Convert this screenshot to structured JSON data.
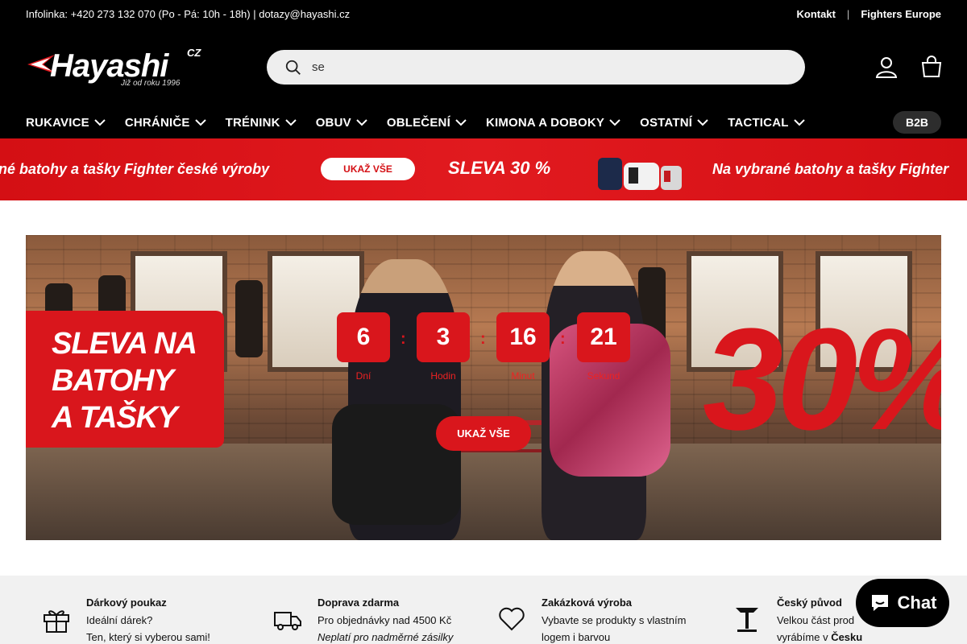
{
  "topbar": {
    "info": "Infolinka: +420 273 132 070 (Po - Pá: 10h - 18h) | dotazy@hayashi.cz",
    "contact_link": "Kontakt",
    "separator": "|",
    "europe_link": "Fighters Europe"
  },
  "logo": {
    "wordmark": "Hayashi",
    "cz": "CZ",
    "tagline": "Již od roku 1996"
  },
  "search": {
    "value": "se"
  },
  "nav": {
    "items": [
      "RUKAVICE",
      "CHRÁNIČE",
      "TRÉNINK",
      "OBUV",
      "OBLEČENÍ",
      "KIMONA A DOBOKY",
      "OSTATNÍ",
      "TACTICAL"
    ],
    "b2b": "B2B"
  },
  "promo_strip": {
    "left_text": "né batohy a tašky Fighter české výroby",
    "button": "UKAŽ VŠE",
    "discount": "SLEVA 30 %",
    "right_text": "Na vybrané batohy a tašky Fighter"
  },
  "hero": {
    "headline": [
      "SLEVA NA",
      "BATOHY",
      "A TAŠKY"
    ],
    "big_text": "30%",
    "countdown": [
      {
        "value": "6",
        "label": "Dní"
      },
      {
        "value": "3",
        "label": "Hodin"
      },
      {
        "value": "16",
        "label": "Minut"
      },
      {
        "value": "21",
        "label": "Sekund"
      }
    ],
    "cta": "UKAŽ VŠE"
  },
  "features": [
    {
      "title": "Dárkový poukaz",
      "line1": "Ideální dárek?",
      "line2": "Ten, který si vyberou sami!",
      "icon": "gift-icon"
    },
    {
      "title": "Doprava zdarma",
      "line1": "Pro objednávky nad 4500 Kč",
      "line2": "Neplatí pro nadměrné zásilky",
      "icon": "truck-icon"
    },
    {
      "title": "Zakázková výroba",
      "line1": "Vybavte se produkty s vlastním",
      "line2": "logem i barvou",
      "icon": "heart-icon"
    },
    {
      "title": "Český původ",
      "line1": "Velkou část prod",
      "line2_prefix": "vyrábíme v ",
      "line2_bold": "Česku",
      "icon": "fighter-logo-icon"
    }
  ],
  "chat": {
    "label": "Chat"
  },
  "colors": {
    "brand_red": "#d9161c",
    "header_bg": "#000000",
    "strip_red": "#e11a1f"
  }
}
